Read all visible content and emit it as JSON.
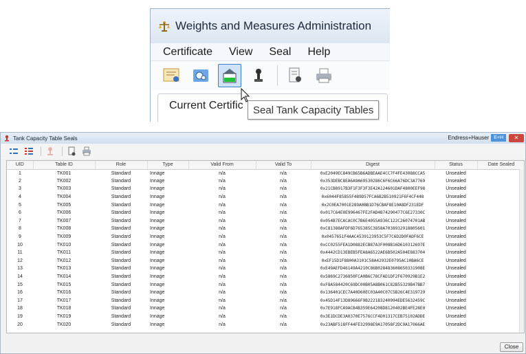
{
  "app": {
    "title": "Weights and Measures Administration",
    "menu": [
      "Certificate",
      "View",
      "Seal",
      "Help"
    ],
    "section_label": "Current Certific",
    "tooltip": "Seal Tank Capacity Tables"
  },
  "dialog": {
    "title": "Tank Capacity Table Seals",
    "brand_name": "Endress+Hauser",
    "brand_badge": "E+H",
    "close_label": "Close",
    "columns": [
      "UID",
      "Table ID",
      "Role",
      "Type",
      "Valid From",
      "Valid To",
      "Digest",
      "Status",
      "Date Sealed"
    ],
    "rows": [
      [
        "1",
        "TK001",
        "Standard",
        "Innage",
        "n/a",
        "n/a",
        "0xE2049EC849CB65B6ADBEAAE4CC7F4FE43088CCA5",
        "Unsealed",
        ""
      ],
      [
        "2",
        "TK002",
        "Standard",
        "Innage",
        "n/a",
        "n/a",
        "0x353DEBC8EA6A9A69530286C6F6C66A76DC3A7769",
        "Unsealed",
        ""
      ],
      [
        "3",
        "TK003",
        "Standard",
        "Innage",
        "n/a",
        "n/a",
        "0x21CB8917B3F1F3F3F3E42A124601DAF4800EEF98",
        "Unsealed",
        ""
      ],
      [
        "4",
        "TK004",
        "Standard",
        "Innage",
        "n/a",
        "n/a",
        "0x6044F85855F489D57FCA6B2B510921F6F4CF448",
        "Unsealed",
        ""
      ],
      [
        "5",
        "TK005",
        "Standard",
        "Innage",
        "n/a",
        "n/a",
        "0x2C0EA7001E289A0BB1D76CBAF8E10A8DF231EDF",
        "Unsealed",
        ""
      ],
      [
        "6",
        "TK006",
        "Standard",
        "Innage",
        "n/a",
        "n/a",
        "0x017C64E0E996467FE2FAD4B74290477C6E27330C",
        "Unsealed",
        ""
      ],
      [
        "7",
        "TK007",
        "Standard",
        "Innage",
        "n/a",
        "n/a",
        "0x054B7ECACAC0C7B6E4055A936C122C26074701AB",
        "Unsealed",
        ""
      ],
      [
        "8",
        "TK008",
        "Standard",
        "Innage",
        "n/a",
        "n/a",
        "0xC81388AFDF6D765385C3858A7038932918805601",
        "Unsealed",
        ""
      ],
      [
        "9",
        "TK009",
        "Standard",
        "Innage",
        "n/a",
        "n/a",
        "0x0457651F4AAC4539123953C5F7C6D2D0FADF6CE",
        "Unsealed",
        ""
      ],
      [
        "10",
        "TK010",
        "Standard",
        "Innage",
        "n/a",
        "n/a",
        "0xCC0255FEA1D0882ECB87A3F008B16D610312697E",
        "Unsealed",
        ""
      ],
      [
        "11",
        "TK011",
        "Standard",
        "Innage",
        "n/a",
        "n/a",
        "0x4442CD13EBEB5FEA8A6522AE6B502A504E883704",
        "Unsealed",
        ""
      ],
      [
        "12",
        "TK012",
        "Standard",
        "Innage",
        "n/a",
        "n/a",
        "0xEF15D1F8800A3101C58A42932E0795AC10BA6CE",
        "Unsealed",
        ""
      ],
      [
        "13",
        "TK013",
        "Standard",
        "Innage",
        "n/a",
        "n/a",
        "0xE49AEFD46149A4210C86B028483608650331908E",
        "Unsealed",
        ""
      ],
      [
        "14",
        "TK014",
        "Standard",
        "Innage",
        "n/a",
        "n/a",
        "0x5869C2736850FCA0B6C78CFAD1DF2F670929B1E2",
        "Unsealed",
        ""
      ],
      [
        "15",
        "TK015",
        "Standard",
        "Innage",
        "n/a",
        "n/a",
        "0xF8A584420C69DC00B05A8B061C82B55329B47BB7",
        "Unsealed",
        ""
      ],
      [
        "16",
        "TK016",
        "Standard",
        "Innage",
        "n/a",
        "n/a",
        "0x136401CEC7A40D60EC03A40C07C5B26C4E319729",
        "Unsealed",
        ""
      ],
      [
        "17",
        "TK017",
        "Standard",
        "Innage",
        "n/a",
        "n/a",
        "0x45D14F13D89666F9B2221B3240994EDE5632459C",
        "Unsealed",
        ""
      ],
      [
        "18",
        "TK018",
        "Standard",
        "Innage",
        "n/a",
        "n/a",
        "0x7E918FCA9ACB4B359E64208D8120402BE4FE28E0",
        "Unsealed",
        ""
      ],
      [
        "19",
        "TK019",
        "Standard",
        "Innage",
        "n/a",
        "n/a",
        "0x3E1DCDE3A0370E7576CCF4D01317CEB75102ADDE",
        "Unsealed",
        ""
      ],
      [
        "20",
        "TK020",
        "Standard",
        "Innage",
        "n/a",
        "n/a",
        "0x23ABF518FF44FE32998E9A17058F2DC9A17066AE",
        "Unsealed",
        ""
      ]
    ]
  },
  "colors": {
    "accent_blue": "#3d7cc9",
    "title_blue": "#d3dfee",
    "close_red": "#c9473d",
    "brand_blue": "#4c93dc"
  },
  "icons": {
    "app_toolbar": [
      "certificate-icon",
      "seal-gears-icon",
      "tank-table-seal-icon",
      "stamp-icon",
      "report-icon",
      "print-icon"
    ],
    "dialog_toolbar": [
      "expand-all-icon",
      "collapse-all-icon",
      "seal-icon",
      "report-icon",
      "print-icon"
    ]
  }
}
